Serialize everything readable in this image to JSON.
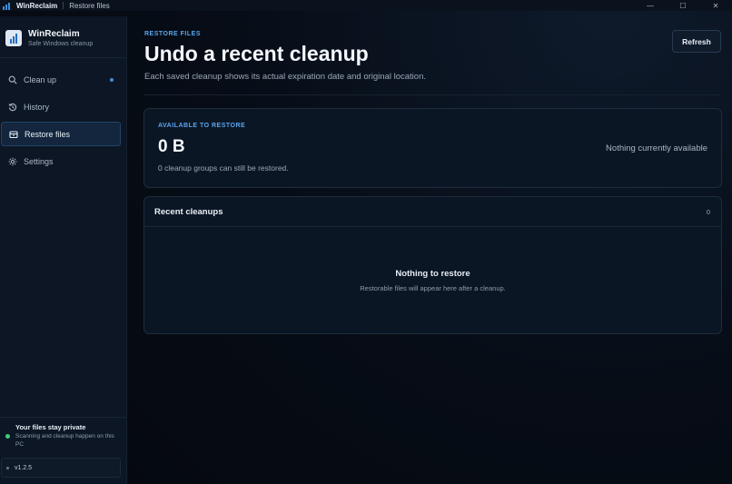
{
  "titlebar": {
    "app_name": "WinReclaim",
    "page_name": "Restore files",
    "controls": {
      "minimize": "—",
      "maximize": "☐",
      "close": "✕"
    }
  },
  "sidebar": {
    "brand_name": "WinReclaim",
    "brand_tagline": "Safe Windows cleanup",
    "items": [
      {
        "label": "Clean up",
        "icon": "search-icon",
        "active": false,
        "badge_dot": true
      },
      {
        "label": "History",
        "icon": "history-icon",
        "active": false
      },
      {
        "label": "Restore files",
        "icon": "restore-icon",
        "active": true
      },
      {
        "label": "Settings",
        "icon": "gear-icon",
        "active": false
      }
    ],
    "privacy_title": "Your files stay private",
    "privacy_text": "Scanning and cleanup happen on this PC",
    "version": "v1.2.5"
  },
  "main": {
    "eyebrow": "RESTORE FILES",
    "title": "Undo a recent cleanup",
    "subtitle": "Each saved cleanup shows its actual expiration date and original location.",
    "refresh_label": "Refresh",
    "summary": {
      "label": "AVAILABLE TO RESTORE",
      "value": "0 B",
      "caption": "0 cleanup groups can still be restored.",
      "status": "Nothing currently available"
    },
    "recent": {
      "title": "Recent cleanups",
      "count": "0",
      "empty_title": "Nothing to restore",
      "empty_text": "Restorable files will appear here after a cleanup."
    }
  },
  "colors": {
    "accent": "#5aa6f0",
    "active_nav": "#13263d",
    "status_ok": "#3ed07a"
  }
}
